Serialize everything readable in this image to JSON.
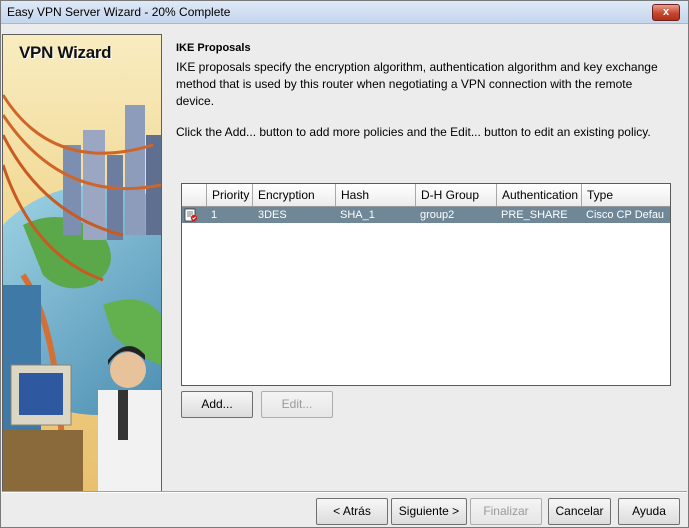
{
  "window": {
    "title": "Easy VPN Server Wizard - 20% Complete",
    "close_glyph": "x"
  },
  "sidebar": {
    "title": "VPN Wizard"
  },
  "section": {
    "heading": "IKE Proposals",
    "description": "IKE proposals specify the encryption algorithm, authentication algorithm and key exchange method that is used by this router when negotiating a VPN connection with the remote device.",
    "hint": "Click the Add... button to add more policies and the Edit... button to edit an existing policy."
  },
  "table": {
    "columns": [
      "",
      "Priority",
      "Encryption",
      "Hash",
      "D-H Group",
      "Authentication",
      "Type"
    ],
    "rows": [
      {
        "icon": "policy-icon",
        "priority": "1",
        "encryption": "3DES",
        "hash": "SHA_1",
        "dh_group": "group2",
        "authentication": "PRE_SHARE",
        "type": "Cisco CP Defau"
      }
    ]
  },
  "actions": {
    "add": "Add...",
    "edit": "Edit..."
  },
  "nav": {
    "back": "< Atrás",
    "next": "Siguiente >",
    "finish": "Finalizar",
    "cancel": "Cancelar",
    "help": "Ayuda"
  }
}
